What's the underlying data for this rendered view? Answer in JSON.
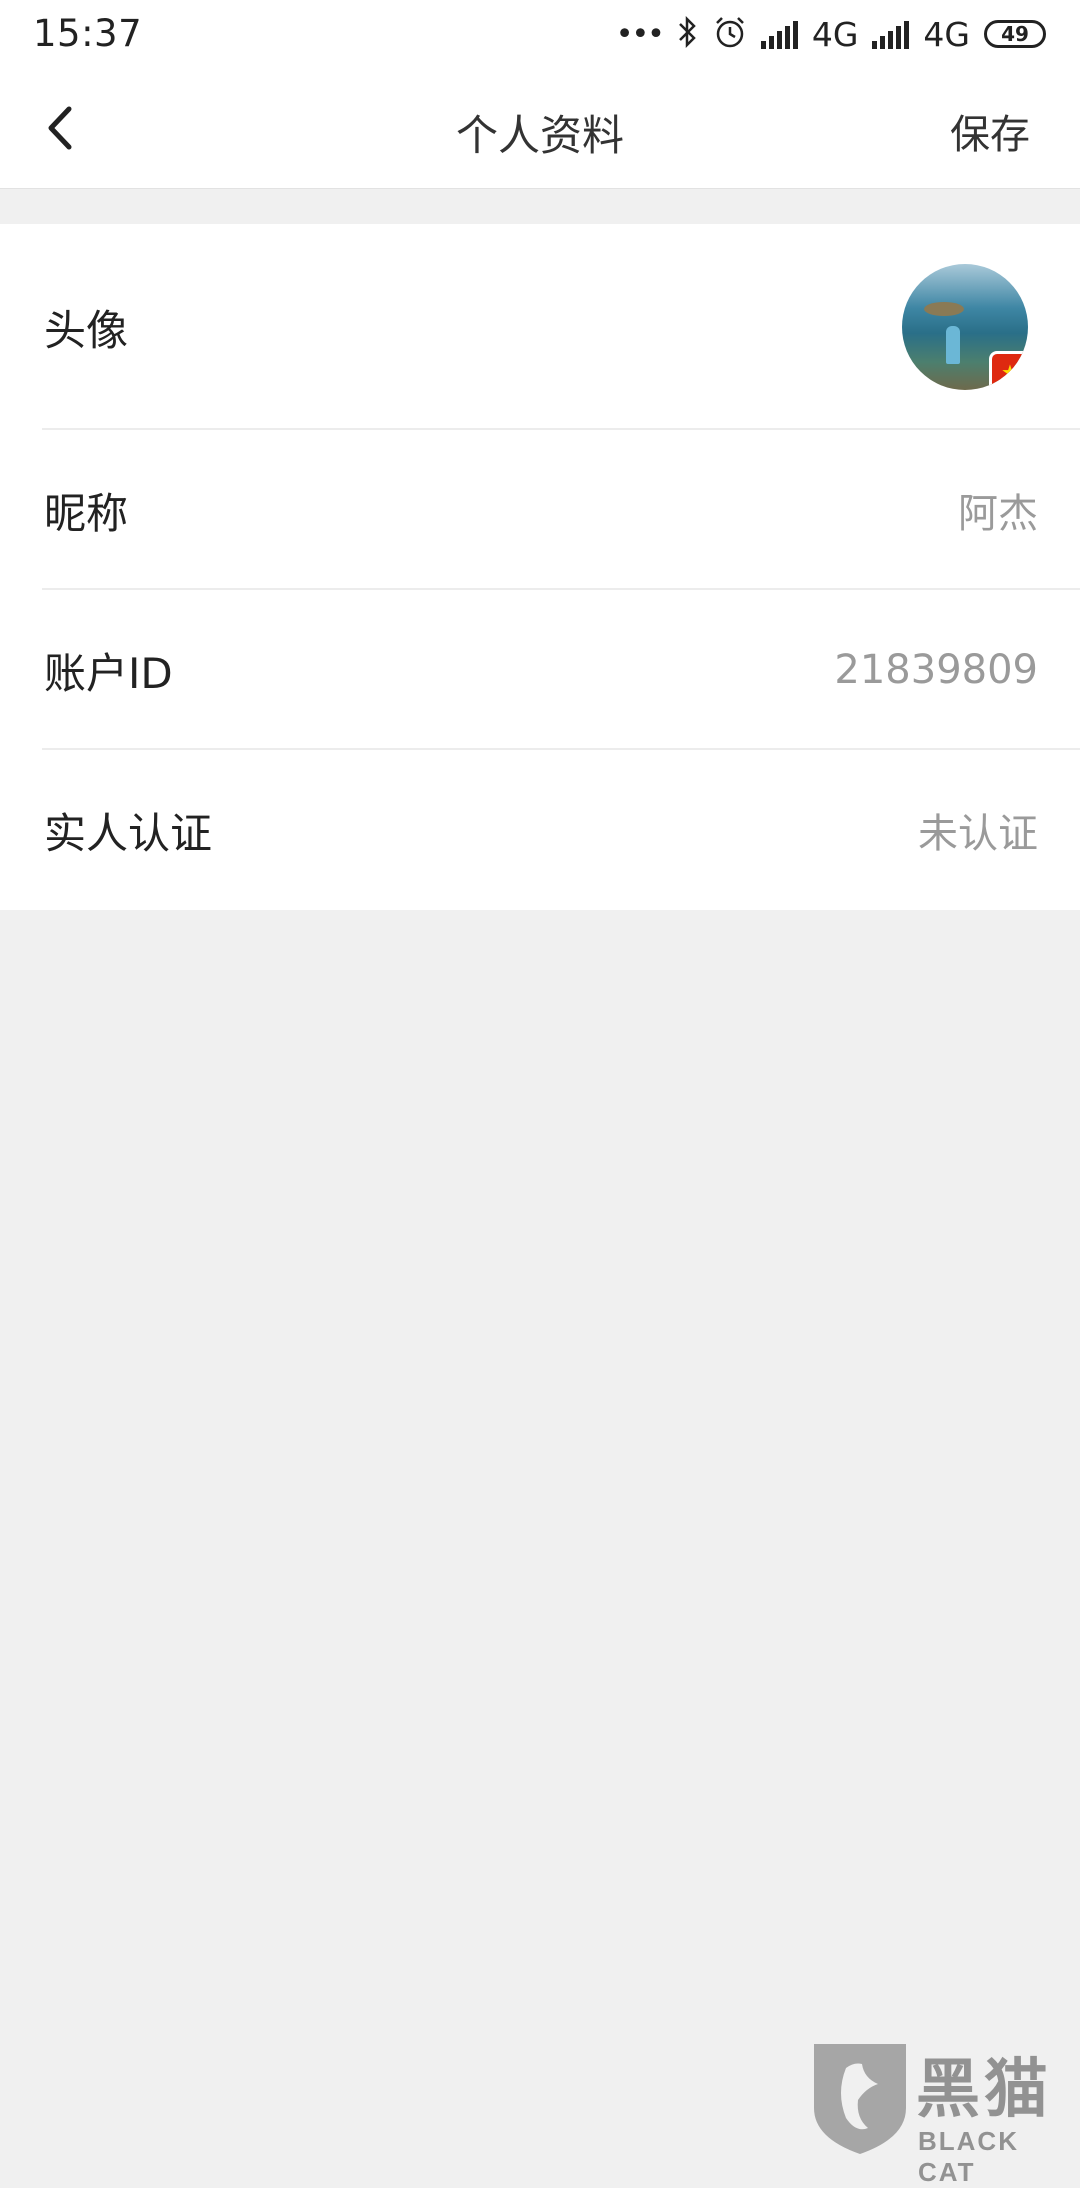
{
  "status_bar": {
    "time": "15:37",
    "network_1": "4G",
    "network_2": "4G",
    "battery": "49",
    "icons": [
      "more-dots-icon",
      "bluetooth-icon",
      "alarm-icon",
      "hd-signal-icon",
      "signal-icon",
      "battery-icon"
    ]
  },
  "header": {
    "title": "个人资料",
    "save_label": "保存",
    "back_icon": "chevron-left-icon"
  },
  "profile": {
    "avatar_label": "头像",
    "nickname_label": "昵称",
    "nickname_value": "阿杰",
    "account_id_label": "账户ID",
    "account_id_value": "21839809",
    "verification_label": "实人认证",
    "verification_value": "未认证"
  },
  "watermark": {
    "title": "黑猫",
    "subtitle": "BLACK CAT"
  },
  "colors": {
    "background": "#f0f0f0",
    "card": "#ffffff",
    "value_text": "#9a9a9a",
    "primary_text": "#222222"
  }
}
